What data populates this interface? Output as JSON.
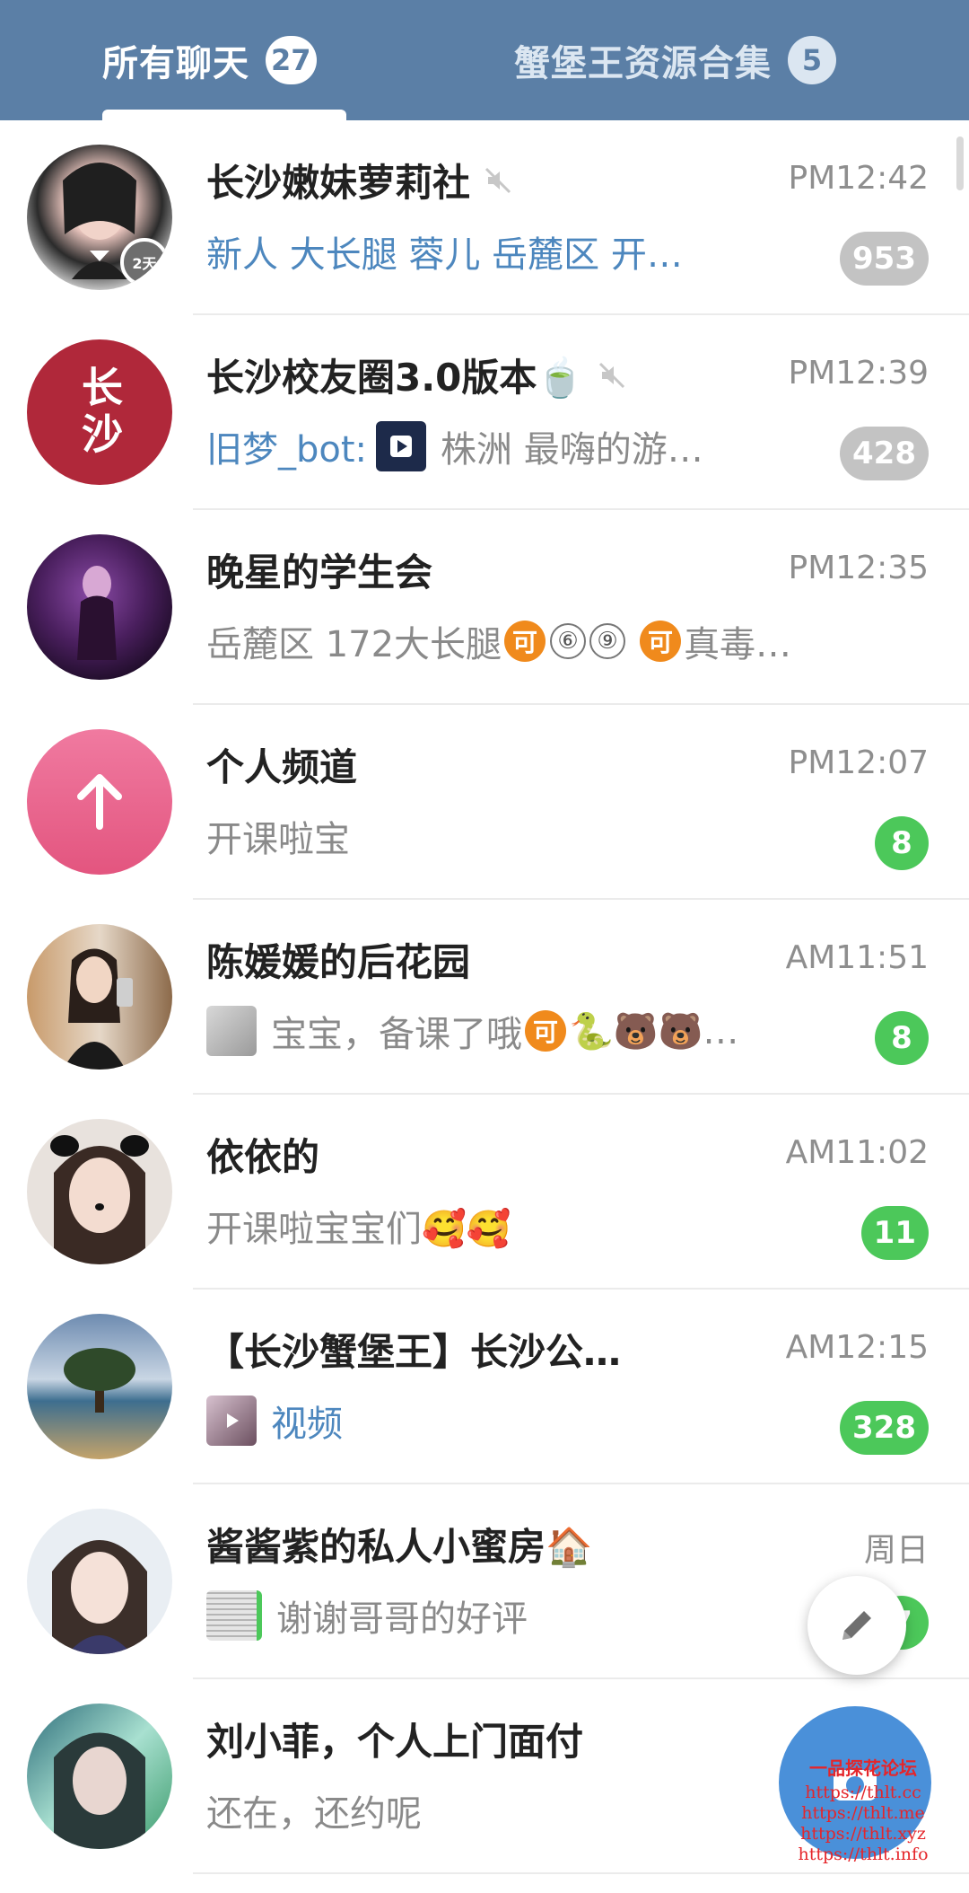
{
  "tabs": [
    {
      "label": "所有聊天",
      "count": "27"
    },
    {
      "label": "蟹堡王资源合集",
      "count": "5"
    }
  ],
  "avatar_badges": {
    "days": "2天"
  },
  "chats": [
    {
      "title": "长沙嫩妹萝莉社",
      "muted": true,
      "time": "PM12:42",
      "preview": "新人 大长腿 蓉儿 岳麓区 开…",
      "badge": "953"
    },
    {
      "title": "长沙校友圈3.0版本🍵",
      "muted": true,
      "time": "PM12:39",
      "sender": "旧梦_bot:",
      "preview": " 株洲 最嗨的游…",
      "badge": "428",
      "avatar_text": "长沙"
    },
    {
      "title": "晚星的学生会",
      "muted": false,
      "time": "PM12:35",
      "preview_a": "岳麓区 172大长腿 ",
      "preview_b": "真毒…"
    },
    {
      "title": "个人频道",
      "muted": false,
      "time": "PM12:07",
      "preview": "开课啦宝",
      "badge": "8"
    },
    {
      "title": "陈媛媛的后花园",
      "muted": false,
      "time": "AM11:51",
      "preview": "宝宝，备课了哦",
      "preview_tail": "🐍🐻🐻…",
      "badge": "8"
    },
    {
      "title": "依依的",
      "muted": false,
      "time": "AM11:02",
      "preview": "开课啦宝宝们🥰🥰",
      "badge": "11"
    },
    {
      "title": "【长沙蟹堡王】长沙公…",
      "muted": false,
      "time": "AM12:15",
      "preview": "视频",
      "badge": "328"
    },
    {
      "title": "酱酱紫的私人小蜜房🏠",
      "muted": false,
      "time": "周日",
      "preview": "谢谢哥哥的好评",
      "badge": "7"
    },
    {
      "title": "刘小菲，个人上门面付",
      "muted": false,
      "time": "",
      "preview": "还在，还约呢",
      "badge": ""
    }
  ],
  "emoji_chars": {
    "ke": "可",
    "six": "⑥",
    "nine": "⑨"
  },
  "watermark": {
    "title": "一品探花论坛",
    "lines": [
      "https://thlt.cc",
      "https://thlt.me",
      "https://thlt.xyz",
      "https://thlt.info"
    ]
  },
  "colors": {
    "header": "#5b7fa6",
    "badge_muted": "#c3c3c3",
    "badge_unread": "#4cc85a",
    "link_blue": "#4d87be"
  },
  "icons": {
    "mute": "speaker-muted-icon",
    "edit": "pencil-icon",
    "camera": "camera-icon",
    "play": "play-icon",
    "channel": "arrow-up-icon"
  }
}
